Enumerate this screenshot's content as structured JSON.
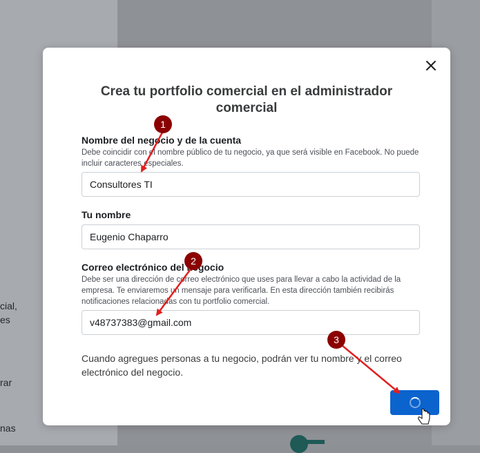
{
  "background": {
    "fragments": [
      "cial,",
      "es",
      "rar",
      "nas"
    ]
  },
  "dialog": {
    "title": "Crea tu portfolio comercial en el administrador comercial",
    "close_icon": "close-icon",
    "business_name": {
      "label": "Nombre del negocio y de la cuenta",
      "help": "Debe coincidir con el nombre público de tu negocio, ya que será visible en Facebook. No puede incluir caracteres especiales.",
      "value": "Consultores TI"
    },
    "your_name": {
      "label": "Tu nombre",
      "value": "Eugenio Chaparro"
    },
    "email": {
      "label": "Correo electrónico del negocio",
      "help": "Debe ser una dirección de correo electrónico que uses para llevar a cabo la actividad de la empresa. Te enviaremos un mensaje para verificarla. En esta dirección también recibirás notificaciones relacionadas con tu portfolio comercial.",
      "value": "v48737383@gmail.com"
    },
    "note": "Cuando agregues personas a tu negocio, podrán ver tu nombre y el correo electrónico del negocio.",
    "submit_icon": "loading-spinner-icon"
  },
  "annotations": {
    "badges": [
      "1",
      "2",
      "3"
    ],
    "color": "#e02020",
    "badge_color": "#8b0000"
  },
  "colors": {
    "accent": "#0b63ce",
    "overlay": "#8e9196"
  }
}
